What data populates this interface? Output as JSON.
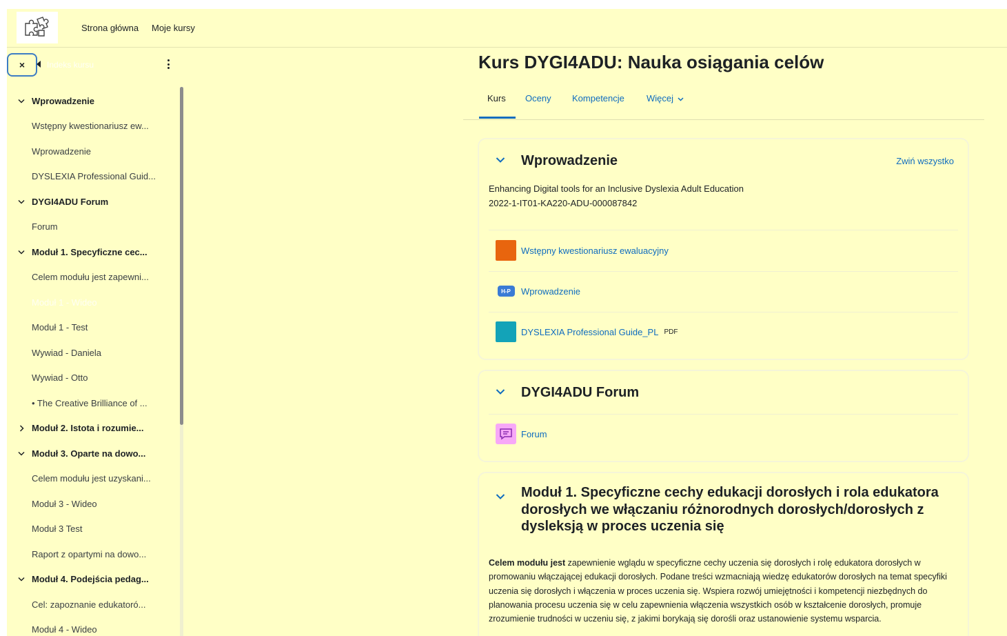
{
  "navbar": {
    "links": [
      "Strona główna",
      "Moje kursy"
    ]
  },
  "drawer": {
    "close_label": "×",
    "search_hint": "Indeks kursu",
    "rows": [
      {
        "type": "section",
        "label": "Wprowadzenie",
        "expanded": true
      },
      {
        "type": "item",
        "label": "Wstępny kwestionariusz ew..."
      },
      {
        "type": "item",
        "label": "Wprowadzenie"
      },
      {
        "type": "item",
        "label": "DYSLEXIA Professional Guid..."
      },
      {
        "type": "section",
        "label": "DYGI4ADU Forum",
        "expanded": true
      },
      {
        "type": "item",
        "label": "Forum"
      },
      {
        "type": "section",
        "label": "Moduł 1. Specyficzne cec...",
        "expanded": true
      },
      {
        "type": "item",
        "label": "Celem modułu jest zapewni..."
      },
      {
        "type": "hidden",
        "label": "Moduł 1 - Wideo"
      },
      {
        "type": "item",
        "label": "Moduł 1 - Test"
      },
      {
        "type": "item",
        "label": "Wywiad - Daniela"
      },
      {
        "type": "item",
        "label": "Wywiad - Otto"
      },
      {
        "type": "item",
        "label": "• The Creative Brilliance of ..."
      },
      {
        "type": "section",
        "label": "Moduł 2. Istota i rozumie...",
        "expanded": false
      },
      {
        "type": "section",
        "label": "Moduł 3. Oparte na dowo...",
        "expanded": true
      },
      {
        "type": "item",
        "label": "Celem modułu jest uzyskani..."
      },
      {
        "type": "item",
        "label": "Moduł 3 - Wideo"
      },
      {
        "type": "item",
        "label": "Moduł 3 Test"
      },
      {
        "type": "item",
        "label": "Raport z opartymi na dowo..."
      },
      {
        "type": "section",
        "label": "Moduł 4. Podejścia pedag...",
        "expanded": true
      },
      {
        "type": "item",
        "label": "Cel: zapoznanie edukatoró..."
      },
      {
        "type": "item",
        "label": "Moduł 4 - Wideo"
      }
    ]
  },
  "page": {
    "title": "Kurs DYGI4ADU: Nauka osiągania celów"
  },
  "tabs": {
    "kurs": "Kurs",
    "oceny": "Oceny",
    "kompetencje": "Kompetencje",
    "wiecej": "Więcej"
  },
  "section1": {
    "title": "Wprowadzenie",
    "collapse_all": "Zwiń wszystko",
    "summary_line1": "Enhancing Digital tools for an Inclusive Dyslexia Adult Education",
    "summary_line2": "2022-1-IT01-KA220-ADU-000087842",
    "activities": {
      "quest": "Wstępny kwestionariusz ewaluacyjny",
      "h5p": "Wprowadzenie",
      "h5p_icon_text": "H-P",
      "pdf": "DYSLEXIA Professional Guide_PL",
      "pdf_badge": "PDF"
    }
  },
  "section2": {
    "title": "DYGI4ADU Forum",
    "activity": "Forum"
  },
  "section3": {
    "title": "Moduł 1. Specyficzne cechy edukacji dorosłych i rola edukatora dorosłych we włączaniu różnorodnych dorosłych/dorosłych z dysleksją w proces uczenia się",
    "text_bold": "Celem modułu jest",
    "text_rest": " zapewnienie wglądu w specyficzne cechy uczenia się dorosłych i rolę edukatora dorosłych w promowaniu włączającej edukacji dorosłych. Podane treści wzmacniają wiedzę edukatorów dorosłych na temat specyfiki uczenia się dorosłych i włączenia w proces uczenia się. Wspiera rozwój umiejętności i kompetencji niezbędnych do planowania procesu uczenia się w celu zapewnienia włączenia wszystkich osób w kształcenie dorosłych, promuje zrozumienie trudności w uczeniu się, z jakimi borykają się dorośli oraz ustanowienie systemu wsparcia."
  },
  "colors": {
    "background": "#ffffc6",
    "link": "#0f6cbf",
    "quest_icon": "#e8650e",
    "h5p_icon": "#3a7bd5",
    "pdf_icon": "#13a3b8",
    "forum_icon": "#f7a8f7"
  },
  "icons": {
    "logo": "puzzle-logo-icon",
    "close": "close-icon",
    "kebab": "kebab-menu-icon",
    "section_toggle": "chevron-down-icon"
  }
}
